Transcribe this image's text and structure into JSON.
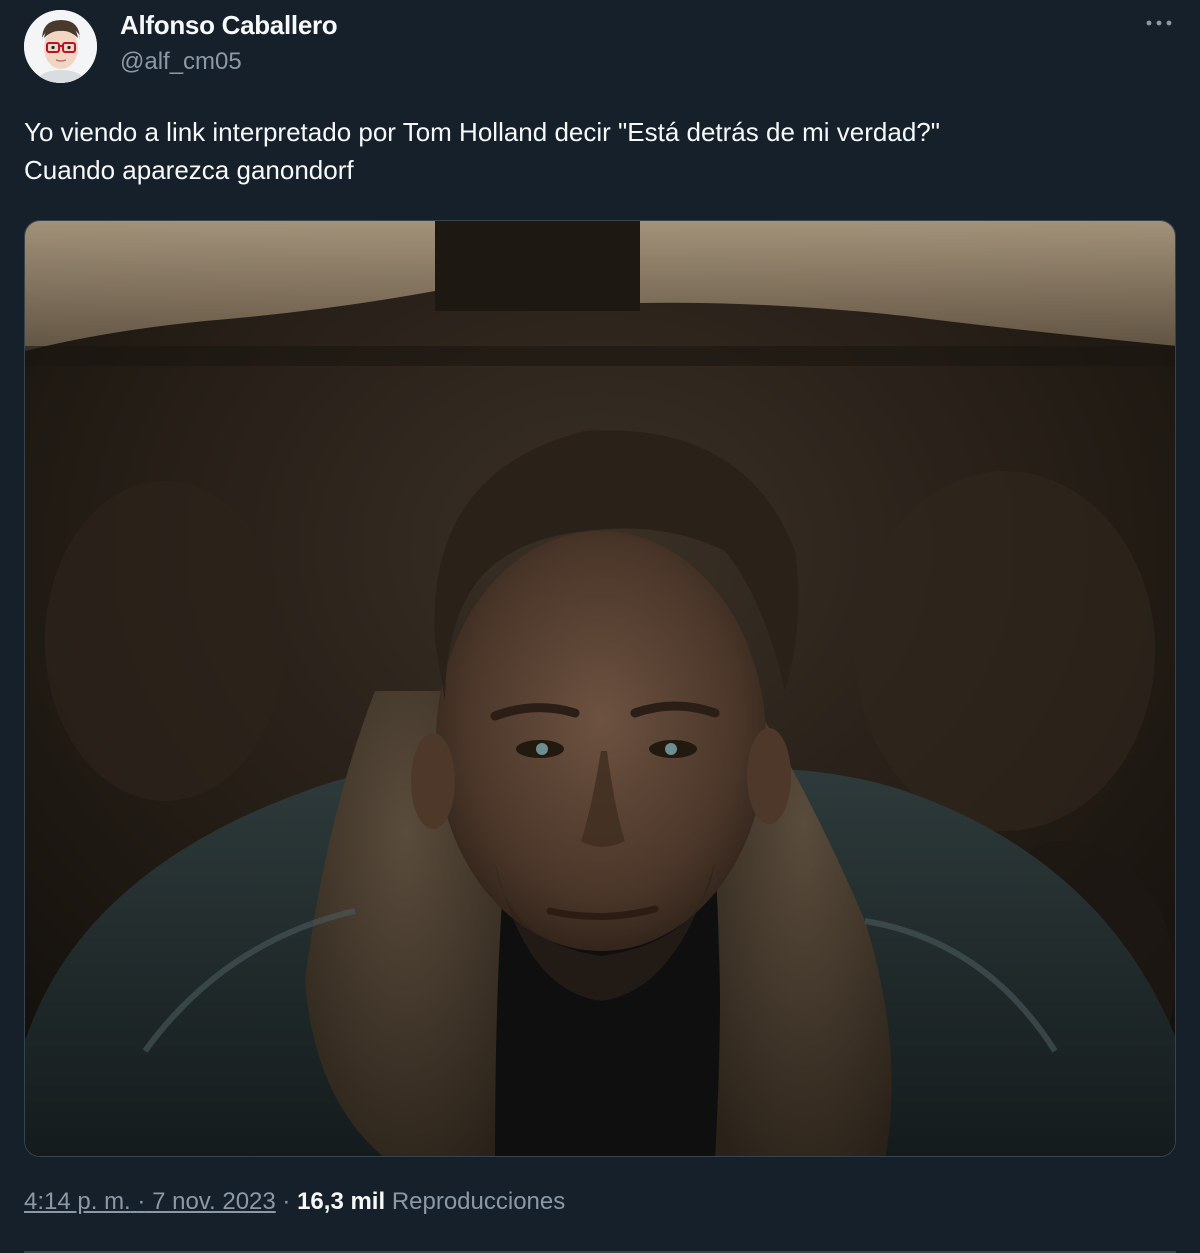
{
  "author": {
    "name": "Alfonso Caballero",
    "handle": "@alf_cm05"
  },
  "tweet": {
    "text": "Yo viendo a link interpretado por Tom Holland decir \"Está detrás de mi verdad?\"\nCuando aparezca ganondorf"
  },
  "meta": {
    "time": "4:14 p. m.",
    "separator": "·",
    "date": "7 nov. 2023",
    "views_count": "16,3 mil",
    "views_label": "Reproducciones"
  },
  "icons": {
    "more": "more-dots-icon"
  },
  "colors": {
    "background": "#15202b",
    "text_primary": "#f7f9f9",
    "text_secondary": "#8b98a5",
    "border": "#38444d"
  }
}
